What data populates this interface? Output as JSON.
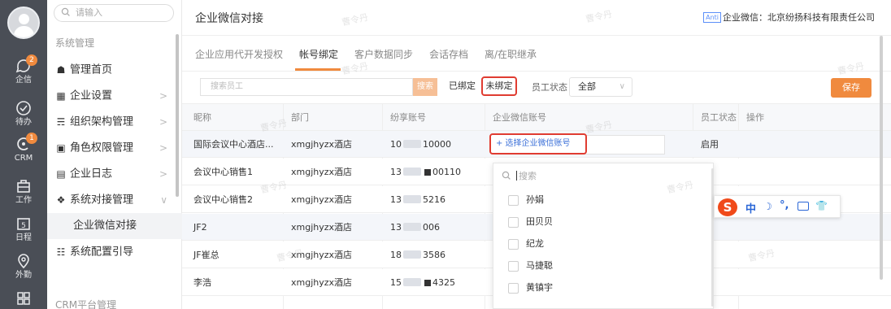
{
  "rail": {
    "items": [
      {
        "label": "企信",
        "icon": "chat-bubble-icon",
        "badge": "2"
      },
      {
        "label": "待办",
        "icon": "check-circle-icon",
        "badge": ""
      },
      {
        "label": "CRM",
        "icon": "crm-icon",
        "badge": "1"
      },
      {
        "label": "工作",
        "icon": "briefcase-icon",
        "badge": ""
      },
      {
        "label": "日程",
        "icon": "calendar-icon",
        "badge": ""
      },
      {
        "label": "外勤",
        "icon": "location-icon",
        "badge": ""
      },
      {
        "label": "",
        "icon": "apps-grid-icon",
        "badge": ""
      }
    ]
  },
  "menu": {
    "search_placeholder": "请输入",
    "section_title": "系统管理",
    "items": [
      {
        "label": "管理首页",
        "icon": "home-icon",
        "chevron": ""
      },
      {
        "label": "企业设置",
        "icon": "company-settings-icon",
        "chevron": ">"
      },
      {
        "label": "组织架构管理",
        "icon": "org-chart-icon",
        "chevron": ">"
      },
      {
        "label": "角色权限管理",
        "icon": "role-permission-icon",
        "chevron": ">"
      },
      {
        "label": "企业日志",
        "icon": "log-icon",
        "chevron": ">"
      },
      {
        "label": "系统对接管理",
        "icon": "link-icon",
        "chevron": "∨"
      },
      {
        "label": "企业微信对接",
        "icon": "",
        "chevron": ""
      },
      {
        "label": "系统配置引导",
        "icon": "config-guide-icon",
        "chevron": ""
      }
    ],
    "footer_section": "CRM平台管理"
  },
  "header": {
    "title": "企业微信对接",
    "company_tag": "Anti",
    "company_text": "企业微信：北京纷扬科技有限责任公司"
  },
  "tabs": [
    {
      "label": "企业应用代开发授权"
    },
    {
      "label": "帐号绑定"
    },
    {
      "label": "客户数据同步"
    },
    {
      "label": "会话存档"
    },
    {
      "label": "离/在职继承"
    }
  ],
  "filters": {
    "search_placeholder": "搜索员工",
    "search_button": "搜索",
    "bound_label": "已绑定",
    "unbound_label": "未绑定",
    "status_label": "员工状态",
    "status_value": "全部",
    "save_button": "保存"
  },
  "table": {
    "headers": [
      "昵称",
      "部门",
      "纷享账号",
      "企业微信账号",
      "员工状态",
      "操作"
    ],
    "rows": [
      {
        "name": "国际会议中心酒店...",
        "dept": "xmgjhyzx酒店",
        "acct_a": "10",
        "acct_b": "10000",
        "wx": "+ 选择企业微信账号",
        "status": "启用"
      },
      {
        "name": "会议中心销售1",
        "dept": "xmgjhyzx酒店",
        "acct_a": "13",
        "acct_b": "00110",
        "wx": "",
        "status": ""
      },
      {
        "name": "会议中心销售2",
        "dept": "xmgjhyzx酒店",
        "acct_a": "13",
        "acct_b": "5216",
        "wx": "",
        "status": ""
      },
      {
        "name": "JF2",
        "dept": "xmgjhyzx酒店",
        "acct_a": "13",
        "acct_b": "006",
        "wx": "",
        "status": ""
      },
      {
        "name": "JF崔总",
        "dept": "xmgjhyzx酒店",
        "acct_a": "18",
        "acct_b": "3586",
        "wx": "",
        "status": ""
      },
      {
        "name": "李浩",
        "dept": "xmgjhyzx酒店",
        "acct_a": "15",
        "acct_b": "4325",
        "wx": "",
        "status": ""
      }
    ]
  },
  "dropdown": {
    "search_placeholder": "搜索",
    "options": [
      "孙娟",
      "田贝贝",
      "纪龙",
      "马捷聪",
      "黄镇宇"
    ]
  },
  "ime": {
    "logo": "S",
    "mode": "中",
    "moon": "☽",
    "punct": "°,",
    "skin": "👕"
  },
  "watermark": "曹令丹",
  "colors": {
    "accent": "#f08a3e",
    "highlight_border": "#e03c31",
    "link": "#3a6fd8",
    "rail_bg": "#4a4e56"
  }
}
